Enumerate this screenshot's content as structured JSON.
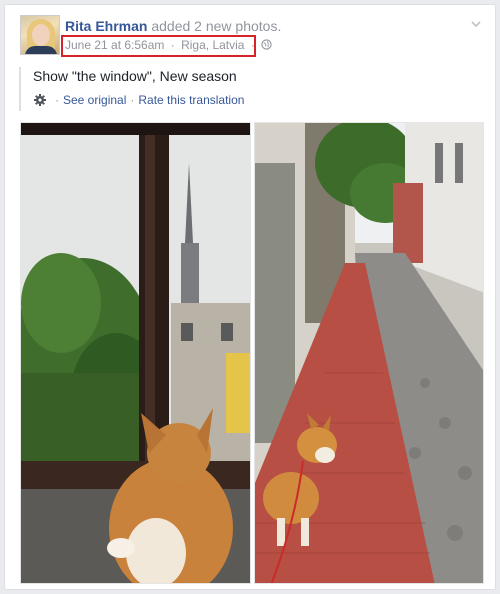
{
  "post": {
    "author": "Rita Ehrman",
    "action": "added 2 new photos.",
    "date": "June 21 at 6:56am",
    "location": "Riga, Latvia",
    "meta_separator": "·",
    "audience_icon": "globe-icon",
    "menu_icon": "chevron-down-icon",
    "highlight_color": "#d62229"
  },
  "translation": {
    "text": "Show \"the window\", New season",
    "settings_icon": "gear-icon",
    "see_original": "See original",
    "separator": "·",
    "rate": "Rate this translation"
  },
  "photos": [
    {
      "name": "dog-at-window-photo"
    },
    {
      "name": "dog-on-street-photo"
    }
  ]
}
